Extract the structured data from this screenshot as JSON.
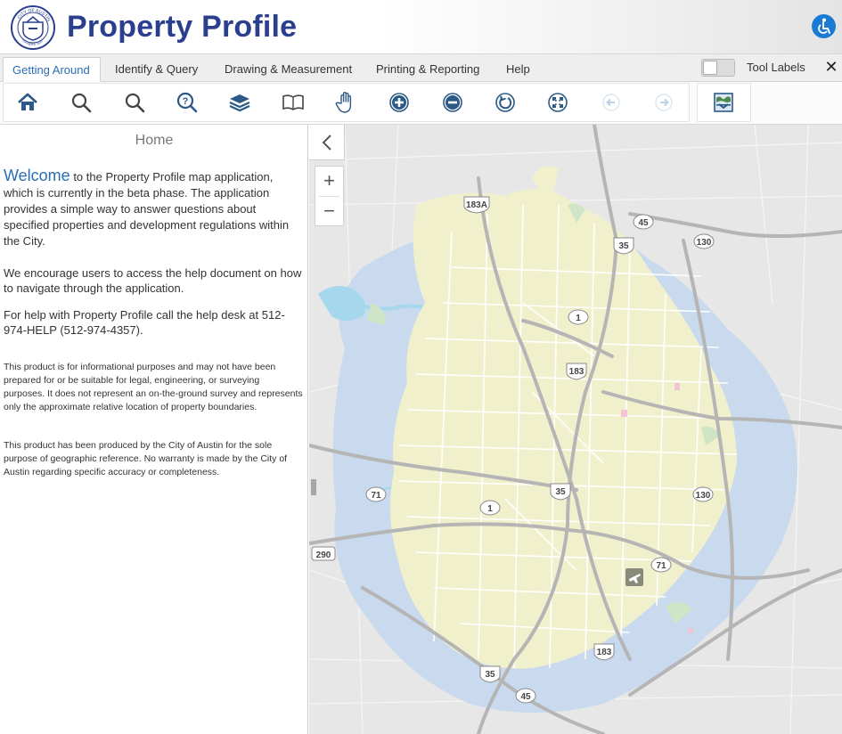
{
  "header": {
    "title": "Property Profile",
    "logo_text": "CITY OF AUSTIN",
    "logo_subtext": "FOUNDED 1839"
  },
  "tabs": [
    {
      "label": "Getting Around"
    },
    {
      "label": "Identify & Query"
    },
    {
      "label": "Drawing & Measurement"
    },
    {
      "label": "Printing & Reporting"
    },
    {
      "label": "Help"
    }
  ],
  "tool_labels_text": "Tool Labels",
  "close_glyph": "✕",
  "toolbar": {
    "icons": [
      "home-icon",
      "search-icon",
      "search-icon",
      "search-help-icon",
      "layers-icon",
      "bookmark-icon",
      "pan-icon",
      "zoom-in-icon",
      "zoom-out-icon",
      "refresh-icon",
      "full-extent-icon",
      "previous-extent-icon",
      "next-extent-icon",
      "overview-map-icon"
    ]
  },
  "panel": {
    "title": "Home",
    "welcome_word": "Welcome",
    "welcome_rest": " to the Property Profile map application, which is currently in the beta phase. The application provides a simple way to answer questions about specified properties and development regulations within the City.",
    "p2": "We encourage users to access the help document on how to navigate through the application.",
    "p3": "For help with Property Profile call the help desk at 512-974-HELP (512-974-4357).",
    "p4": "This product is for informational purposes and may not have been prepared for or be suitable for legal, engineering, or surveying purposes. It does not represent an on-the-ground survey and represents only the approximate relative location of property boundaries.",
    "p5": "This product has been produced by the City of Austin for the sole purpose of geographic reference. No warranty is made by the City of Austin regarding specific accuracy or completeness."
  },
  "map": {
    "zoom_in": "+",
    "zoom_out": "−",
    "collapse_glyph": "‹",
    "route_labels": [
      "183A",
      "45",
      "35",
      "130",
      "1",
      "183",
      "35",
      "130",
      "71",
      "1",
      "290",
      "71",
      "183",
      "35",
      "45"
    ],
    "colors": {
      "city_fill": "#f1f0cc",
      "etj_fill": "#c9d9ee",
      "water": "#a5d8ec",
      "road": "#ffffff",
      "highway": "#b5b5b5",
      "background": "#e7e7e7"
    }
  },
  "accent_color": "#2a6cb5",
  "title_color": "#2b3f8f"
}
